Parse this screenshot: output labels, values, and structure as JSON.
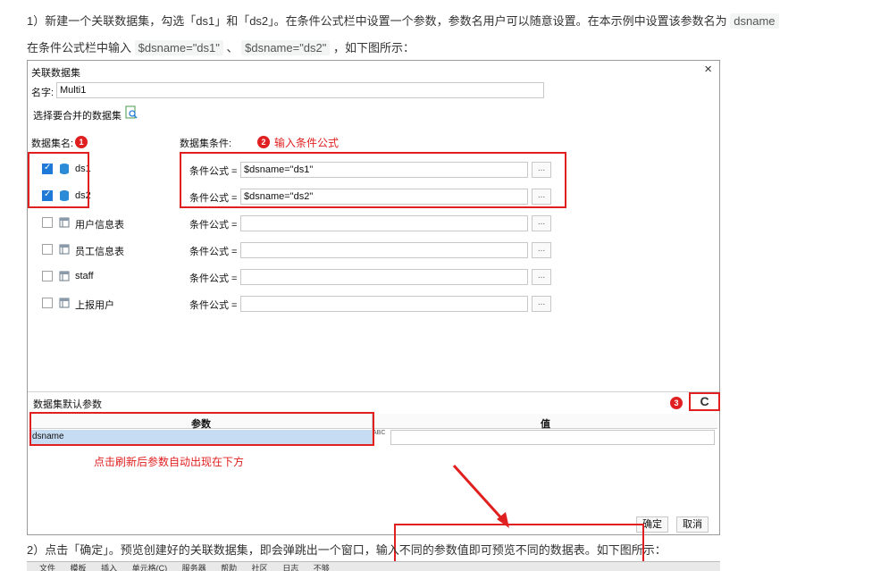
{
  "article": {
    "line1_text": "1）新建一个关联数据集，勾选「ds1」和「ds2」。在条件公式栏中设置一个参数，参数名用户可以随意设置。在本示例中设置该参数名为 ",
    "line1_code": "dsname",
    "line2_text": "在条件公式栏中输入 ",
    "line2_code1": "$dsname=\"ds1\"",
    "line2_sep": " 、 ",
    "line2_code2": "$dsname=\"ds2\"",
    "line2_end": " ，如下图所示：",
    "line3_text": "2）点击「确定」。预览创建好的关联数据集，即会弹跳出一个窗口，输入不同的参数值即可预览不同的数据表。如下图所示："
  },
  "dialog": {
    "title": "关联数据集",
    "close_label": "×",
    "name_label": "名字:",
    "name_value": "Multi1",
    "select_label": "选择要合并的数据集",
    "datasets_header": "数据集名:",
    "conditions_header": "数据集条件:",
    "annotation1": "1",
    "annotation2": "2",
    "annotation2_text": "输入条件公式",
    "condition_label": "条件公式 =",
    "more_label": "...",
    "rows": [
      {
        "name": "ds1",
        "checked": true,
        "formula": "$dsname=\"ds1\""
      },
      {
        "name": "ds2",
        "checked": true,
        "formula": "$dsname=\"ds2\""
      },
      {
        "name": "用户信息表",
        "checked": false,
        "formula": ""
      },
      {
        "name": "员工信息表",
        "checked": false,
        "formula": ""
      },
      {
        "name": "staff",
        "checked": false,
        "formula": ""
      },
      {
        "name": "上报用户",
        "checked": false,
        "formula": ""
      }
    ],
    "params_title": "数据集默认参数",
    "annotation3": "3",
    "refresh_label": "C",
    "params_col_param": "参数",
    "params_col_value": "值",
    "param_row_name": "dsname",
    "param_type_label": "ABC",
    "refresh_note": "点击刷新后参数自动出现在下方",
    "ok_label": "确定",
    "cancel_label": "取消"
  },
  "strip": {
    "items": [
      "文件",
      "模板",
      "插入",
      "单元格(C)",
      "服务器",
      "帮助",
      "社区",
      "日志",
      "不够"
    ]
  }
}
